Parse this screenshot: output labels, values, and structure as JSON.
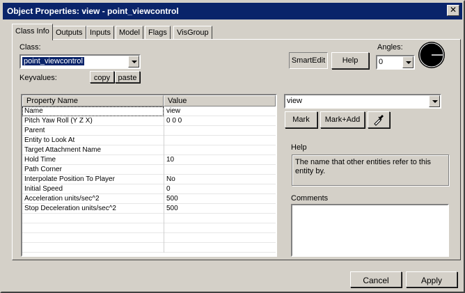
{
  "window": {
    "title": "Object Properties: view - point_viewcontrol"
  },
  "tabs": [
    {
      "label": "Class Info"
    },
    {
      "label": "Outputs"
    },
    {
      "label": "Inputs"
    },
    {
      "label": "Model"
    },
    {
      "label": "Flags"
    },
    {
      "label": "VisGroup"
    }
  ],
  "class_info": {
    "class_label": "Class:",
    "class_value": "point_viewcontrol",
    "keyvalues_label": "Keyvalues:",
    "copy_label": "copy",
    "paste_label": "paste",
    "smartedit_label": "SmartEdit",
    "help_button_label": "Help",
    "angles_label": "Angles:",
    "angles_value": "0"
  },
  "grid": {
    "headers": {
      "name": "Property Name",
      "value": "Value"
    },
    "rows": [
      {
        "name": "Name",
        "value": "view"
      },
      {
        "name": "Pitch Yaw Roll (Y Z X)",
        "value": "0 0 0"
      },
      {
        "name": "Parent",
        "value": ""
      },
      {
        "name": "Entity to Look At",
        "value": ""
      },
      {
        "name": "Target Attachment Name",
        "value": ""
      },
      {
        "name": "Hold Time",
        "value": "10"
      },
      {
        "name": "Path Corner",
        "value": ""
      },
      {
        "name": "Interpolate Position To Player",
        "value": "No"
      },
      {
        "name": "Initial Speed",
        "value": "0"
      },
      {
        "name": "Acceleration units/sec^2",
        "value": "500"
      },
      {
        "name": "Stop Deceleration units/sec^2",
        "value": "500"
      }
    ]
  },
  "editor": {
    "value_combo": "view",
    "mark_label": "Mark",
    "mark_add_label": "Mark+Add",
    "help_label": "Help",
    "help_text": "The name that other entities refer to this entity by.",
    "comments_label": "Comments",
    "comments_text": ""
  },
  "footer": {
    "cancel_label": "Cancel",
    "apply_label": "Apply"
  },
  "colors": {
    "titlebar": "#0a246a",
    "face": "#d4d0c8",
    "selection": "#0a246a"
  }
}
